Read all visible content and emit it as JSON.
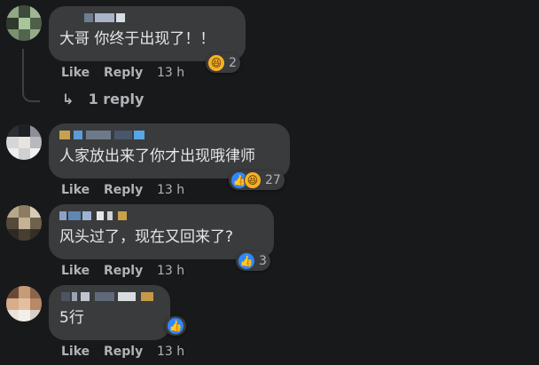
{
  "comments": [
    {
      "name": "",
      "text": "大哥 你终于出现了！！",
      "like_label": "Like",
      "reply_label": "Reply",
      "time": "13 h",
      "reactions": [
        "haha"
      ],
      "reaction_count": "2",
      "replies_label": "1 reply"
    },
    {
      "name": "",
      "text": "人家放出来了你才出现哦律师",
      "like_label": "Like",
      "reply_label": "Reply",
      "time": "13 h",
      "reactions": [
        "like",
        "haha"
      ],
      "reaction_count": "27"
    },
    {
      "name": "",
      "text": "风头过了，现在又回来了?",
      "like_label": "Like",
      "reply_label": "Reply",
      "time": "13 h",
      "reactions": [
        "like"
      ],
      "reaction_count": "3"
    },
    {
      "name": "",
      "text": "5行",
      "like_label": "Like",
      "reply_label": "Reply",
      "time": "13 h",
      "reactions": [
        "like"
      ],
      "reaction_count": ""
    }
  ],
  "icons": {
    "like": "like-icon",
    "haha": "haha-icon",
    "reply_arrow": "reply-arrow-icon"
  },
  "colors": {
    "background": "#18191a",
    "bubble": "#3a3b3c",
    "like_blue": "#2d88ff",
    "haha_yellow": "#f7b125",
    "muted_text": "#b0b3b8"
  }
}
